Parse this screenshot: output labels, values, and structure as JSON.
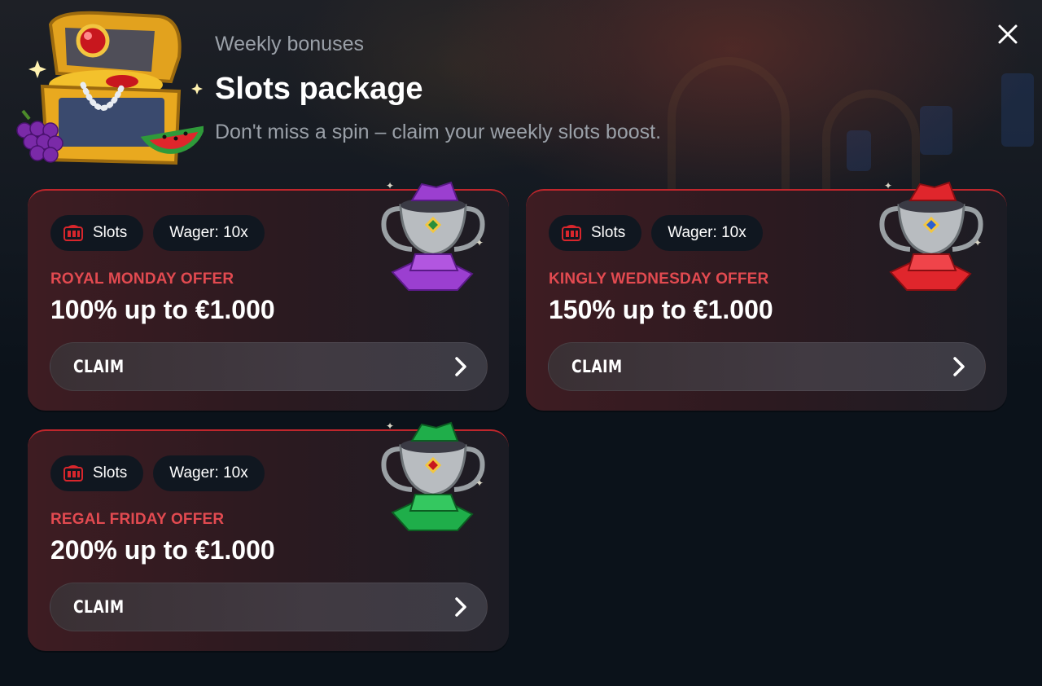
{
  "header": {
    "subtitle": "Weekly bonuses",
    "title": "Slots package",
    "description": "Don't miss a spin – claim your weekly slots boost."
  },
  "close_icon": "close-icon",
  "accent_color": "#e24a50",
  "cards": [
    {
      "chip_slots": "Slots",
      "chip_wager": "Wager: 10x",
      "offer_name": "ROYAL MONDAY OFFER",
      "offer_amount": "100% up to €1.000",
      "claim_label": "CLAIM",
      "trophy_gem_color": "#9b3fd0"
    },
    {
      "chip_slots": "Slots",
      "chip_wager": "Wager: 10x",
      "offer_name": "KINGLY WEDNESDAY OFFER",
      "offer_amount": "150% up to €1.000",
      "claim_label": "CLAIM",
      "trophy_gem_color": "#e0262c"
    },
    {
      "chip_slots": "Slots",
      "chip_wager": "Wager: 10x",
      "offer_name": "REGAL FRIDAY OFFER",
      "offer_amount": "200% up to €1.000",
      "claim_label": "CLAIM",
      "trophy_gem_color": "#1fae4a"
    }
  ]
}
